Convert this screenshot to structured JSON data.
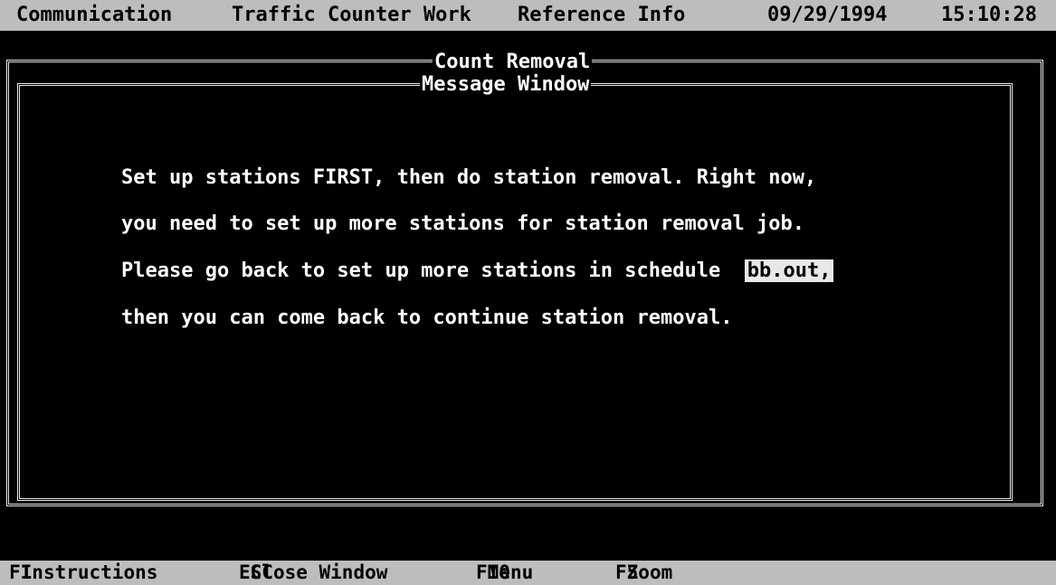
{
  "menubar": {
    "items": [
      "Communication",
      "Traffic Counter Work",
      "Reference Info"
    ],
    "date": "09/29/1994",
    "time": "15:10:28"
  },
  "outer_window": {
    "title": "Count Removal"
  },
  "message_window": {
    "title": "Message Window",
    "lines": [
      "Set up stations FIRST, then do station removal. Right now,",
      "you need to set up more stations for station removal job.",
      "Please go back to set up more stations in schedule",
      "then you can come back to continue station removal."
    ],
    "schedule_name": "bb.out,"
  },
  "statusbar": {
    "keys": [
      {
        "key": "F1",
        "label": "Instructions"
      },
      {
        "key": "ESC",
        "label": "Close Window"
      },
      {
        "key": "F10",
        "label": "Menu"
      },
      {
        "key": "F5",
        "label": "Zoom"
      }
    ]
  }
}
